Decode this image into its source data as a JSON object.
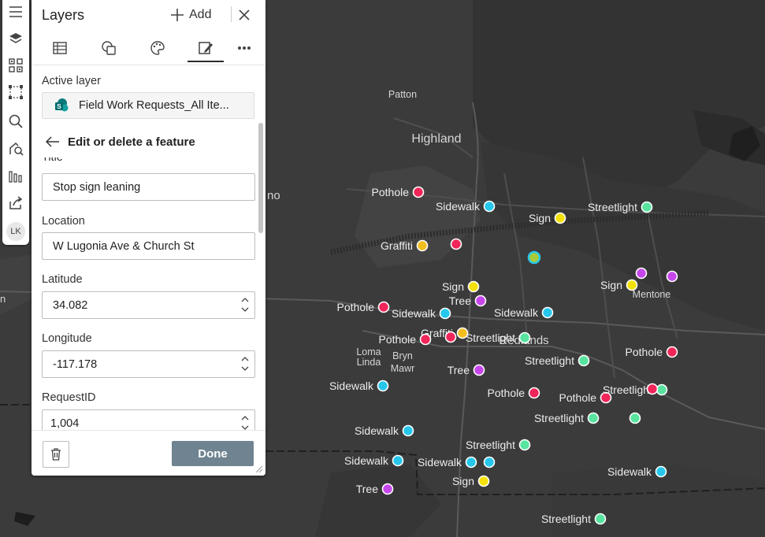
{
  "panel": {
    "title": "Layers",
    "add_label": "Add",
    "active_layer_label": "Active layer",
    "active_layer_name": "Field Work Requests_All Ite...",
    "edit_title": "Edit or delete a feature",
    "partial_label": "Title",
    "title_value": "Stop sign leaning",
    "location_label": "Location",
    "location_value": "W Lugonia Ave & Church St",
    "latitude_label": "Latitude",
    "latitude_value": "34.082",
    "longitude_label": "Longitude",
    "longitude_value": "-117.178",
    "requestid_label": "RequestID",
    "requestid_value": "1,004",
    "done_label": "Done"
  },
  "toolbar": {
    "avatar_initials": "LK",
    "icons": [
      "menu-icon",
      "layers-icon",
      "basemap-gallery-icon",
      "select-icon",
      "search-icon",
      "locate-icon",
      "analysis-icon",
      "share-icon"
    ]
  },
  "map": {
    "places": {
      "patton": "Patton",
      "highland": "Highland",
      "mentone": "Mentone",
      "redlands": "Redlands",
      "loma_linda": [
        "Loma",
        "Linda"
      ],
      "bryn_mawr": [
        "Bryn",
        "Mawr"
      ],
      "cut_left": "no",
      "cut_left2": "n"
    },
    "features": [
      {
        "label": "Pothole",
        "type": "pothole"
      },
      {
        "label": "Sidewalk",
        "type": "sidewalk"
      },
      {
        "label": "Sign",
        "type": "sign"
      },
      {
        "label": "Streetlight",
        "type": "streetlight"
      },
      {
        "label": "Graffiti",
        "type": "graffiti"
      },
      {
        "label": "Sign",
        "type": "sign"
      },
      {
        "label": "Tree",
        "type": "tree"
      },
      {
        "label": "Pothole",
        "type": "pothole"
      },
      {
        "label": "Sidewalk",
        "type": "sidewalk"
      },
      {
        "label": "Sidewalk",
        "type": "sidewalk"
      },
      {
        "label": "Graffiti",
        "type": "graffiti"
      },
      {
        "label": "Pothole",
        "type": "pothole"
      },
      {
        "label": "Streetlight",
        "type": "streetlight"
      },
      {
        "label": "Sign",
        "type": "sign"
      },
      {
        "label": "Pothole",
        "type": "pothole"
      },
      {
        "label": "Tree",
        "type": "tree"
      },
      {
        "label": "Streetlight",
        "type": "streetlight"
      },
      {
        "label": "Sidewalk",
        "type": "sidewalk"
      },
      {
        "label": "Pothole",
        "type": "pothole"
      },
      {
        "label": "Pothole",
        "type": "pothole"
      },
      {
        "label": "Streetlight",
        "type": "streetlight"
      },
      {
        "label": "Streetlight",
        "type": "streetlight"
      },
      {
        "label": "Sidewalk",
        "type": "sidewalk"
      },
      {
        "label": "Streetlight",
        "type": "streetlight"
      },
      {
        "label": "Sidewalk",
        "type": "sidewalk"
      },
      {
        "label": "Sidewalk",
        "type": "sidewalk"
      },
      {
        "label": "Sign",
        "type": "sign"
      },
      {
        "label": "Tree",
        "type": "tree"
      },
      {
        "label": "Sidewalk",
        "type": "sidewalk"
      },
      {
        "label": "Streetlight",
        "type": "streetlight"
      }
    ],
    "colors": {
      "pothole": "#f0265a",
      "sidewalk": "#27c7ec",
      "sign": "#f4e10a",
      "streetlight": "#58e39f",
      "tree": "#c646ec",
      "graffiti": "#f2bd1e",
      "selected": "#a6cc3b"
    }
  }
}
